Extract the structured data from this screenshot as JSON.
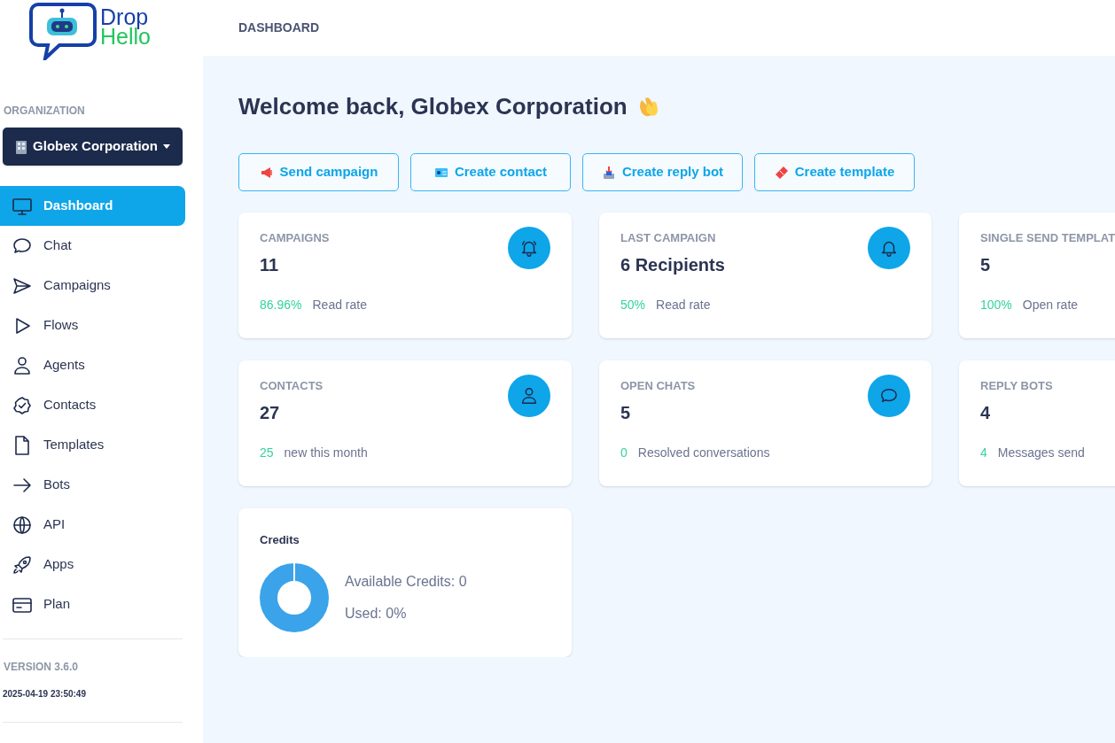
{
  "logo": {
    "word_1": "Drop",
    "word_2": "Hello"
  },
  "header": {
    "title": "DASHBOARD"
  },
  "sidebar": {
    "org_label": "ORGANIZATION",
    "org_selector": "Globex Corporation",
    "items": [
      {
        "label": "Dashboard",
        "selected": true
      },
      {
        "label": "Chat",
        "selected": false
      },
      {
        "label": "Campaigns",
        "selected": false
      },
      {
        "label": "Flows",
        "selected": false
      },
      {
        "label": "Agents",
        "selected": false
      },
      {
        "label": "Contacts",
        "selected": false
      },
      {
        "label": "Templates",
        "selected": false
      },
      {
        "label": "Bots",
        "selected": false
      },
      {
        "label": "API",
        "selected": false
      },
      {
        "label": "Apps",
        "selected": false
      },
      {
        "label": "Plan",
        "selected": false
      }
    ],
    "version": "VERSION 3.6.0",
    "build_time": "2025-04-19 23:50:49"
  },
  "welcome": "Welcome back, Globex Corporation",
  "actions": [
    "Send campaign",
    "Create contact",
    "Create reply bot",
    "Create template"
  ],
  "stats": [
    {
      "title": "CAMPAIGNS",
      "value": "11",
      "metric": "86.96%",
      "metric_label": "Read rate"
    },
    {
      "title": "LAST CAMPAIGN",
      "value": "6 Recipients",
      "metric": "50%",
      "metric_label": "Read rate"
    },
    {
      "title": "SINGLE SEND TEMPLAT",
      "value": "5",
      "metric": "100%",
      "metric_label": "Open rate"
    },
    {
      "title": "CONTACTS",
      "value": "27",
      "metric": "25",
      "metric_label": "new this month"
    },
    {
      "title": "OPEN CHATS",
      "value": "5",
      "metric": "0",
      "metric_label": "Resolved conversations"
    },
    {
      "title": "REPLY BOTS",
      "value": "4",
      "metric": "4",
      "metric_label": "Messages send"
    }
  ],
  "credits": {
    "title": "Credits",
    "available": "Available Credits: 0",
    "used": "Used: 0%"
  }
}
